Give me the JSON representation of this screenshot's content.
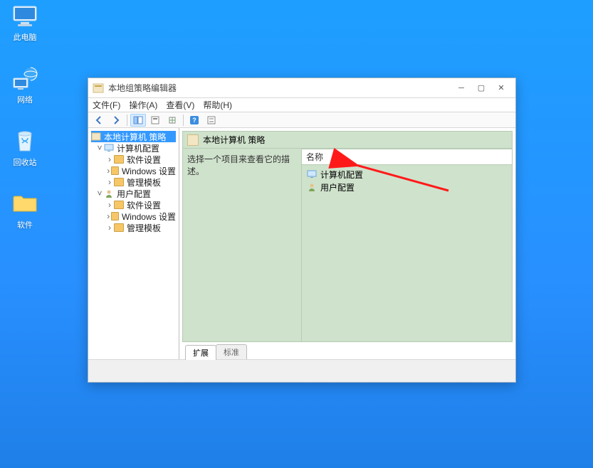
{
  "desktop": {
    "icons": [
      {
        "name": "此电脑"
      },
      {
        "name": "网络"
      },
      {
        "name": "回收站"
      },
      {
        "name": "软件"
      }
    ]
  },
  "window": {
    "title": "本地组策略编辑器",
    "menus": {
      "file": "文件(F)",
      "action": "操作(A)",
      "view": "查看(V)",
      "help": "帮助(H)"
    },
    "tree": {
      "root": "本地计算机 策略",
      "computer_config": "计算机配置",
      "software_settings": "软件设置",
      "windows_settings": "Windows 设置",
      "admin_templates": "管理模板",
      "user_config": "用户配置"
    },
    "right": {
      "header": "本地计算机 策略",
      "description_prompt": "选择一个项目来查看它的描述。",
      "name_col": "名称",
      "items": {
        "computer_config": "计算机配置",
        "user_config": "用户配置"
      }
    },
    "tabs": {
      "extended": "扩展",
      "standard": "标准"
    }
  }
}
